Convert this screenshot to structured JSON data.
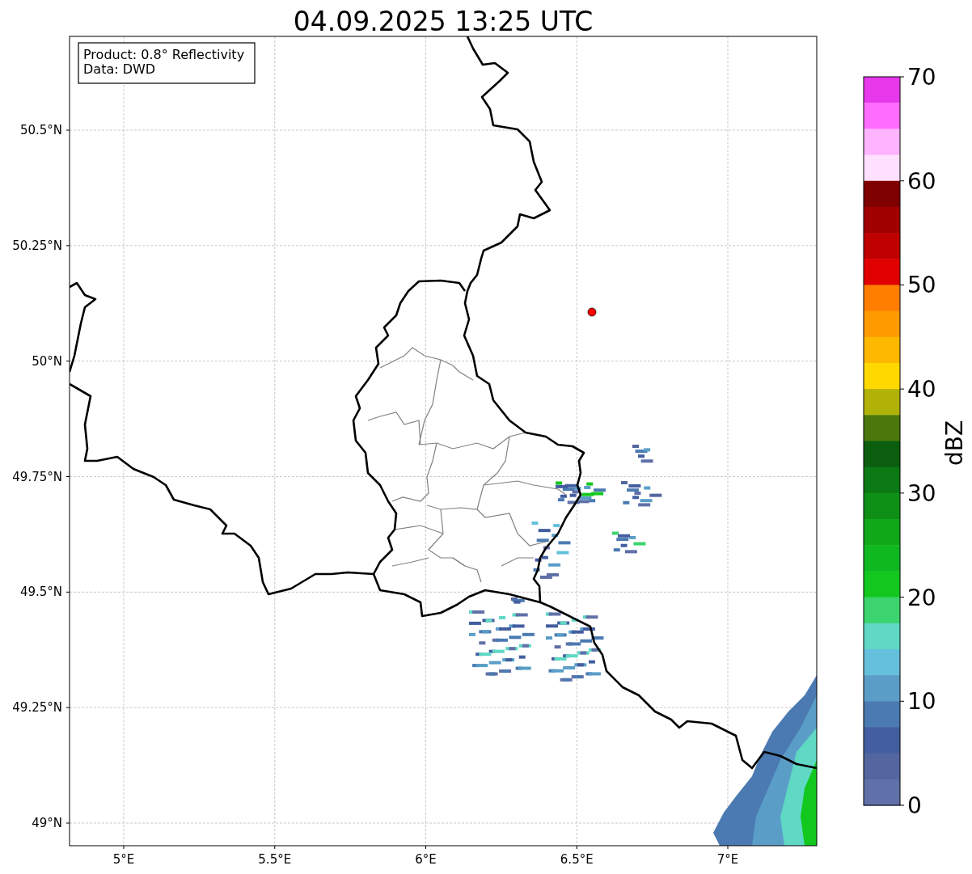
{
  "title": "04.09.2025 13:25 UTC",
  "info_box": [
    "Product: 0.8° Reflectivity",
    "Data: DWD"
  ],
  "lat_ticks": [
    "50.5°N",
    "50.25°N",
    "50°N",
    "49.75°N",
    "49.5°N",
    "49.25°N",
    "49°N"
  ],
  "lon_ticks": [
    "5°E",
    "5.5°E",
    "6°E",
    "6.5°E",
    "7°E"
  ],
  "colorbar": {
    "label": "dBZ",
    "ticks": [
      "70",
      "60",
      "50",
      "40",
      "30",
      "20",
      "10",
      "0"
    ],
    "bins": [
      {
        "color": "#e838ec"
      },
      {
        "color": "#ff6cff"
      },
      {
        "color": "#ffb4ff"
      },
      {
        "color": "#ffe0ff"
      },
      {
        "color": "#7e0000"
      },
      {
        "color": "#a00000"
      },
      {
        "color": "#c00000"
      },
      {
        "color": "#e00000"
      },
      {
        "color": "#ff7e00"
      },
      {
        "color": "#ff9a00"
      },
      {
        "color": "#ffb800"
      },
      {
        "color": "#ffd800"
      },
      {
        "color": "#b0b208"
      },
      {
        "color": "#4a780c"
      },
      {
        "color": "#0a5e0e"
      },
      {
        "color": "#0c7a14"
      },
      {
        "color": "#0e9016"
      },
      {
        "color": "#0fa818"
      },
      {
        "color": "#10b820"
      },
      {
        "color": "#12c81e"
      },
      {
        "color": "#3cd46e"
      },
      {
        "color": "#5fd8c4"
      },
      {
        "color": "#64c0dc"
      },
      {
        "color": "#5a9ec8"
      },
      {
        "color": "#4b7ab2"
      },
      {
        "color": "#435ea0"
      },
      {
        "color": "#5366a0"
      },
      {
        "color": "#6070a8"
      }
    ]
  }
}
